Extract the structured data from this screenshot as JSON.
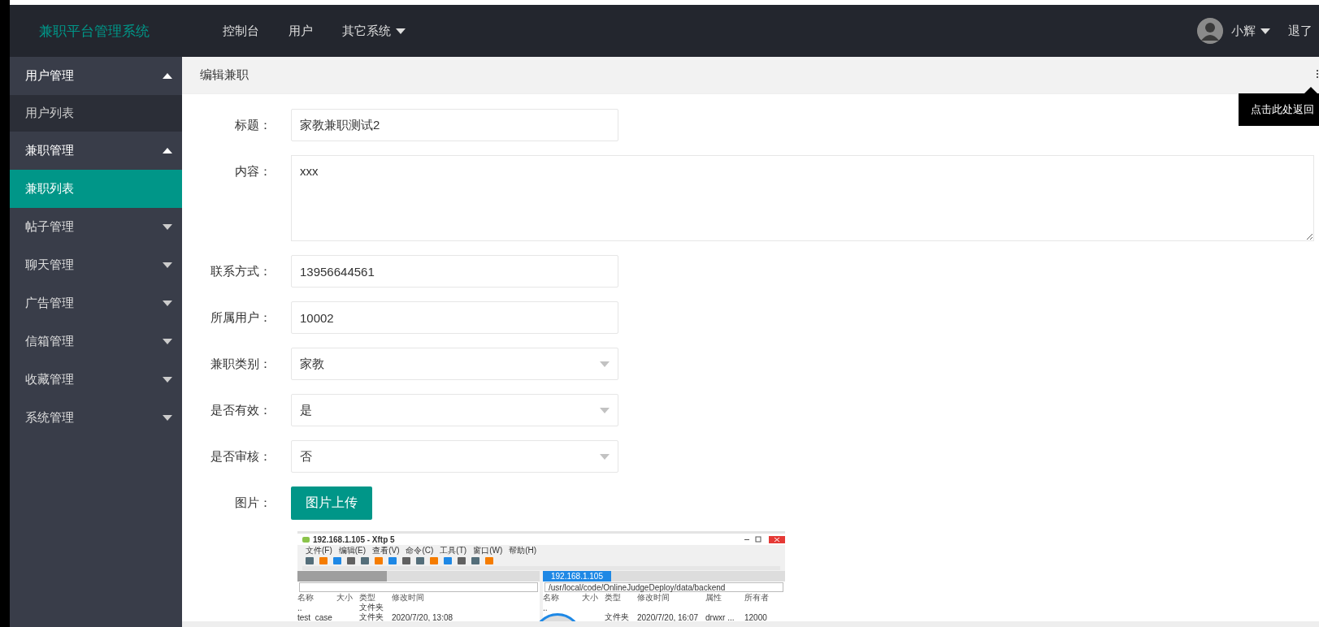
{
  "header": {
    "brand": "兼职平台管理系统",
    "nav": [
      {
        "label": "控制台",
        "dropdown": false
      },
      {
        "label": "用户",
        "dropdown": false
      },
      {
        "label": "其它系统",
        "dropdown": true
      }
    ],
    "user": {
      "name": "小辉",
      "dropdown": true
    },
    "logout": "退了"
  },
  "sidebar": {
    "groups": [
      {
        "label": "用户管理",
        "expanded": true,
        "children": [
          {
            "label": "用户列表",
            "selected": false
          }
        ]
      },
      {
        "label": "兼职管理",
        "expanded": true,
        "children": [
          {
            "label": "兼职列表",
            "selected": true
          }
        ]
      },
      {
        "label": "帖子管理",
        "expanded": false
      },
      {
        "label": "聊天管理",
        "expanded": false
      },
      {
        "label": "广告管理",
        "expanded": false
      },
      {
        "label": "信箱管理",
        "expanded": false
      },
      {
        "label": "收藏管理",
        "expanded": false
      },
      {
        "label": "系统管理",
        "expanded": false
      }
    ]
  },
  "panel": {
    "title": "编辑兼职",
    "tooltip": "点击此处返回"
  },
  "form": {
    "fields": [
      {
        "kind": "text",
        "label": "标题：",
        "value": "家教兼职测试2"
      },
      {
        "kind": "textarea",
        "label": "内容：",
        "value": "xxx"
      },
      {
        "kind": "text",
        "label": "联系方式：",
        "value": "13956644561"
      },
      {
        "kind": "text",
        "label": "所属用户：",
        "value": "10002"
      },
      {
        "kind": "select",
        "label": "兼职类别：",
        "value": "家教"
      },
      {
        "kind": "select",
        "label": "是否有效：",
        "value": "是"
      },
      {
        "kind": "select",
        "label": "是否审核：",
        "value": "否"
      },
      {
        "kind": "upload",
        "label": "图片：",
        "button": "图片上传"
      }
    ]
  },
  "preview": {
    "title": "192.168.1.105  - Xftp 5",
    "menu": [
      "文件(F)",
      "编辑(E)",
      "查看(V)",
      "命令(C)",
      "工具(T)",
      "窗口(W)",
      "帮助(H)"
    ],
    "panes": [
      {
        "columns": [
          "名称",
          "大小",
          "类型",
          "修改时间"
        ],
        "rows": [
          {
            "name": "..",
            "type": "文件夹"
          },
          {
            "name": "test_case",
            "type": "文件夹",
            "modified": "2020/7/20, 13:08"
          }
        ]
      },
      {
        "tab": "192.168.1.105",
        "path": "/usr/local/code/OnlineJudgeDeploy/data/backend",
        "columns": [
          "名称",
          "大小",
          "类型",
          "修改时间",
          "属性",
          "所有者"
        ],
        "rows": [
          {
            "name": ".."
          },
          {
            "type": "文件夹",
            "modified": "2020/7/20, 16:07",
            "attributes": "drwxr ...",
            "owner": "12000"
          }
        ]
      }
    ]
  }
}
